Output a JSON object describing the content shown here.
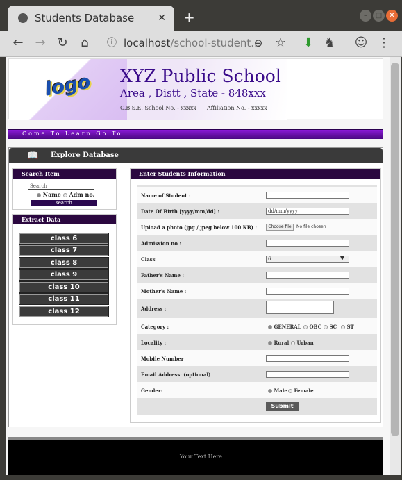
{
  "browser": {
    "tab_title": "Students Database",
    "url_host": "localhost",
    "url_path": "/school-student..."
  },
  "header": {
    "logo_text": "logo",
    "school_name": "XYZ Public School",
    "address": "Area , Distt , State - 848xxx",
    "cbse_no": "C.B.S.E. School No. - xxxxx",
    "affiliation_no": "Affiliation No. - xxxxx"
  },
  "marquee": "Come To Learn Go To",
  "main": {
    "title": "Explore Database"
  },
  "search_panel": {
    "title": "Search Item",
    "placeholder": "Search",
    "option_name": "Name",
    "option_adm": "Adm no.",
    "button": "search"
  },
  "extract_panel": {
    "title": "Extract Data",
    "classes": [
      "class 6",
      "class 7",
      "class 8",
      "class 9",
      "class 10",
      "class 11",
      "class 12"
    ]
  },
  "form": {
    "title": "Enter Students Information",
    "name_label": "Name of Student :",
    "dob_label": "Date Of Birth [yyyy/mm/dd] :",
    "dob_placeholder": "dd/mm/yyyy",
    "photo_label": "Upload a photo (jpg / jpeg below 100 KB) :",
    "choose_file": "Choose file",
    "no_file": "No file chosen",
    "admission_label": "Admission no :",
    "class_label": "Class",
    "class_value": "6",
    "father_label": "Father's Name :",
    "mother_label": "Mother's Name :",
    "address_label": "Address :",
    "category_label": "Category :",
    "categories": [
      "GENERAL",
      "OBC",
      "SC",
      "ST"
    ],
    "locality_label": "Locality :",
    "localities": [
      "Rural",
      "Urban"
    ],
    "mobile_label": "Mobile Number",
    "email_label": "Email Address: (optional)",
    "gender_label": "Gender:",
    "genders": [
      "Male",
      "Female"
    ],
    "submit": "Submit"
  },
  "footer": {
    "text": "Your Text Here"
  }
}
